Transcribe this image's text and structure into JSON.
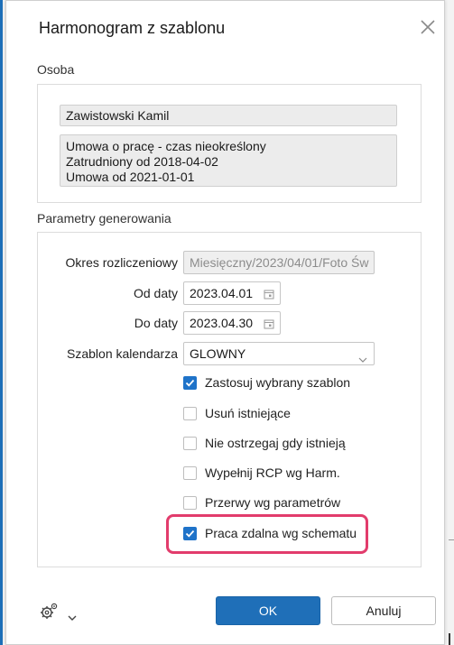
{
  "dialog": {
    "title": "Harmonogram z szablonu",
    "close_icon": "close-icon"
  },
  "person": {
    "section_label": "Osoba",
    "name": "Zawistowski Kamil",
    "contract_lines": [
      "Umowa o pracę - czas nieokreślony",
      "Zatrudniony od 2018-04-02",
      "Umowa od 2021-01-01"
    ]
  },
  "params": {
    "section_label": "Parametry generowania",
    "period_label": "Okres rozliczeniowy",
    "period_value": "Miesięczny/2023/04/01/Foto Św",
    "from_label": "Od daty",
    "from_value": "2023.04.01",
    "to_label": "Do daty",
    "to_value": "2023.04.30",
    "template_label": "Szablon kalendarza",
    "template_value": "GLOWNY"
  },
  "options": [
    {
      "label": "Zastosuj wybrany szablon",
      "checked": true
    },
    {
      "label": "Usuń istniejące",
      "checked": false
    },
    {
      "label": "Nie ostrzegaj gdy istnieją",
      "checked": false
    },
    {
      "label": "Wypełnij RCP wg Harm.",
      "checked": false
    },
    {
      "label": "Przerwy wg parametrów",
      "checked": false
    },
    {
      "label": "Praca zdalna wg schematu",
      "checked": true
    }
  ],
  "footer": {
    "settings_icon": "gear-icon",
    "ok_label": "OK",
    "cancel_label": "Anuluj"
  },
  "colors": {
    "accent": "#1f6fb8",
    "highlight": "#e23c6c"
  }
}
